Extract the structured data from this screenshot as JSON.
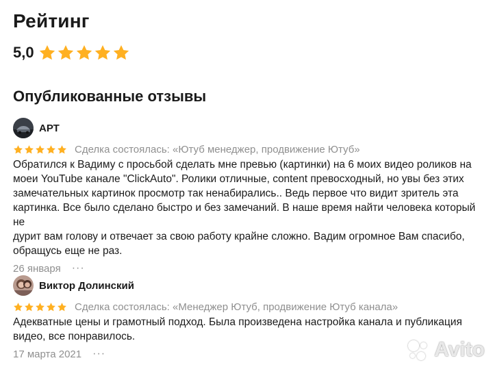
{
  "header": {
    "title": "Рейтинг"
  },
  "rating": {
    "value": "5,0",
    "stars": 5
  },
  "colors": {
    "star": "#ffb021",
    "muted": "#8f8f8f"
  },
  "section": {
    "title": "Опубликованные отзывы"
  },
  "reviews": [
    {
      "author": "АРТ",
      "stars": 5,
      "deal": "Сделка состоялась: «Ютуб менеджер, продвижение Ютуб»",
      "lines": [
        "Обратился к Вадиму с просьбой сделать мне превью (картинки) на 6 моих видео роликов на",
        "моеи YouTube канале \"ClickAuto\". Ролики отличные, content превосходный, но увы без этих",
        "замечательных картинок просмотр так ненабирались.. Ведь первое что видит зритель эта",
        "картинка. Все было сделано быстро и без замечаний. В наше время найти человека который не",
        "дурит вам голову и отвечает за свою работу крайне сложно. Вадим огромное Вам спасибо,",
        "обращусь еще не раз."
      ],
      "date": "26 января",
      "more": "···"
    },
    {
      "author": "Виктор Долинский",
      "stars": 5,
      "deal": "Сделка состоялась: «Менеджер Ютуб, продвижение Ютуб канала»",
      "lines": [
        "Адекватные цены и грамотный подход. Была произведена настройка канала и публикация",
        "видео, все понравилось."
      ],
      "date": "17 марта 2021",
      "more": "···"
    }
  ],
  "watermark": {
    "text": "Avito"
  }
}
